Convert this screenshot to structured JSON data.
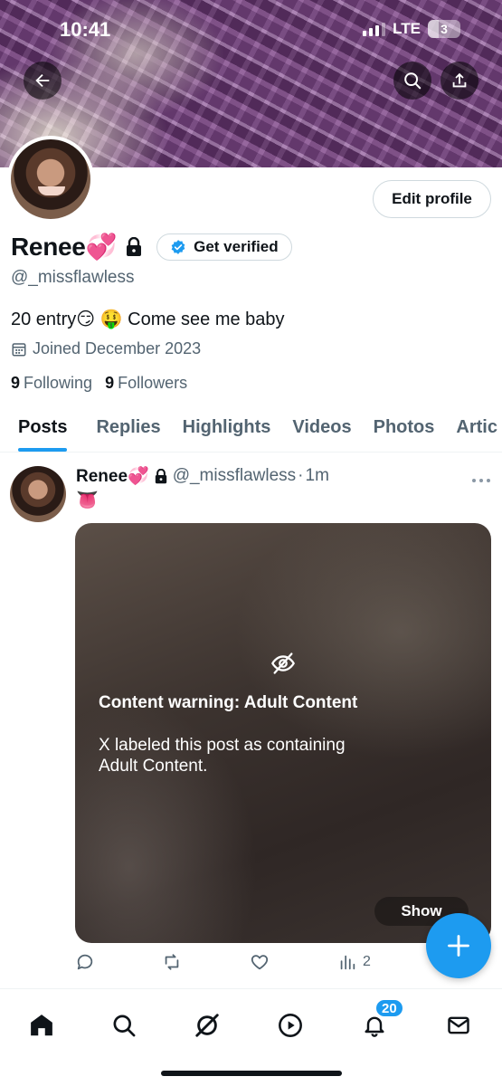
{
  "status_bar": {
    "time": "10:41",
    "network": "LTE",
    "battery_level": "3"
  },
  "profile": {
    "display_name": "Renee💞",
    "handle": "@_missflawless",
    "verify_label": "Get verified",
    "edit_label": "Edit profile",
    "bio": "20 entry😏 🤑 Come see me baby",
    "joined": "Joined December 2023",
    "following_count": "9",
    "following_label": "Following",
    "followers_count": "9",
    "followers_label": "Followers"
  },
  "tabs": [
    {
      "label": "Posts",
      "active": true
    },
    {
      "label": "Replies"
    },
    {
      "label": "Highlights"
    },
    {
      "label": "Videos"
    },
    {
      "label": "Photos"
    },
    {
      "label": "Artic"
    }
  ],
  "post": {
    "name": "Renee💞",
    "handle": "@_missflawless",
    "separator": "·",
    "time": "1m",
    "text": "👅",
    "warning_title": "Content warning: Adult Content",
    "warning_desc": "X labeled this post as containing Adult Content.",
    "show_label": "Show",
    "views": "2"
  },
  "nav": {
    "notifications_badge": "20"
  },
  "colors": {
    "accent": "#1d9bf0",
    "text": "#0f1419",
    "muted": "#536471",
    "border": "#cfd9de"
  }
}
